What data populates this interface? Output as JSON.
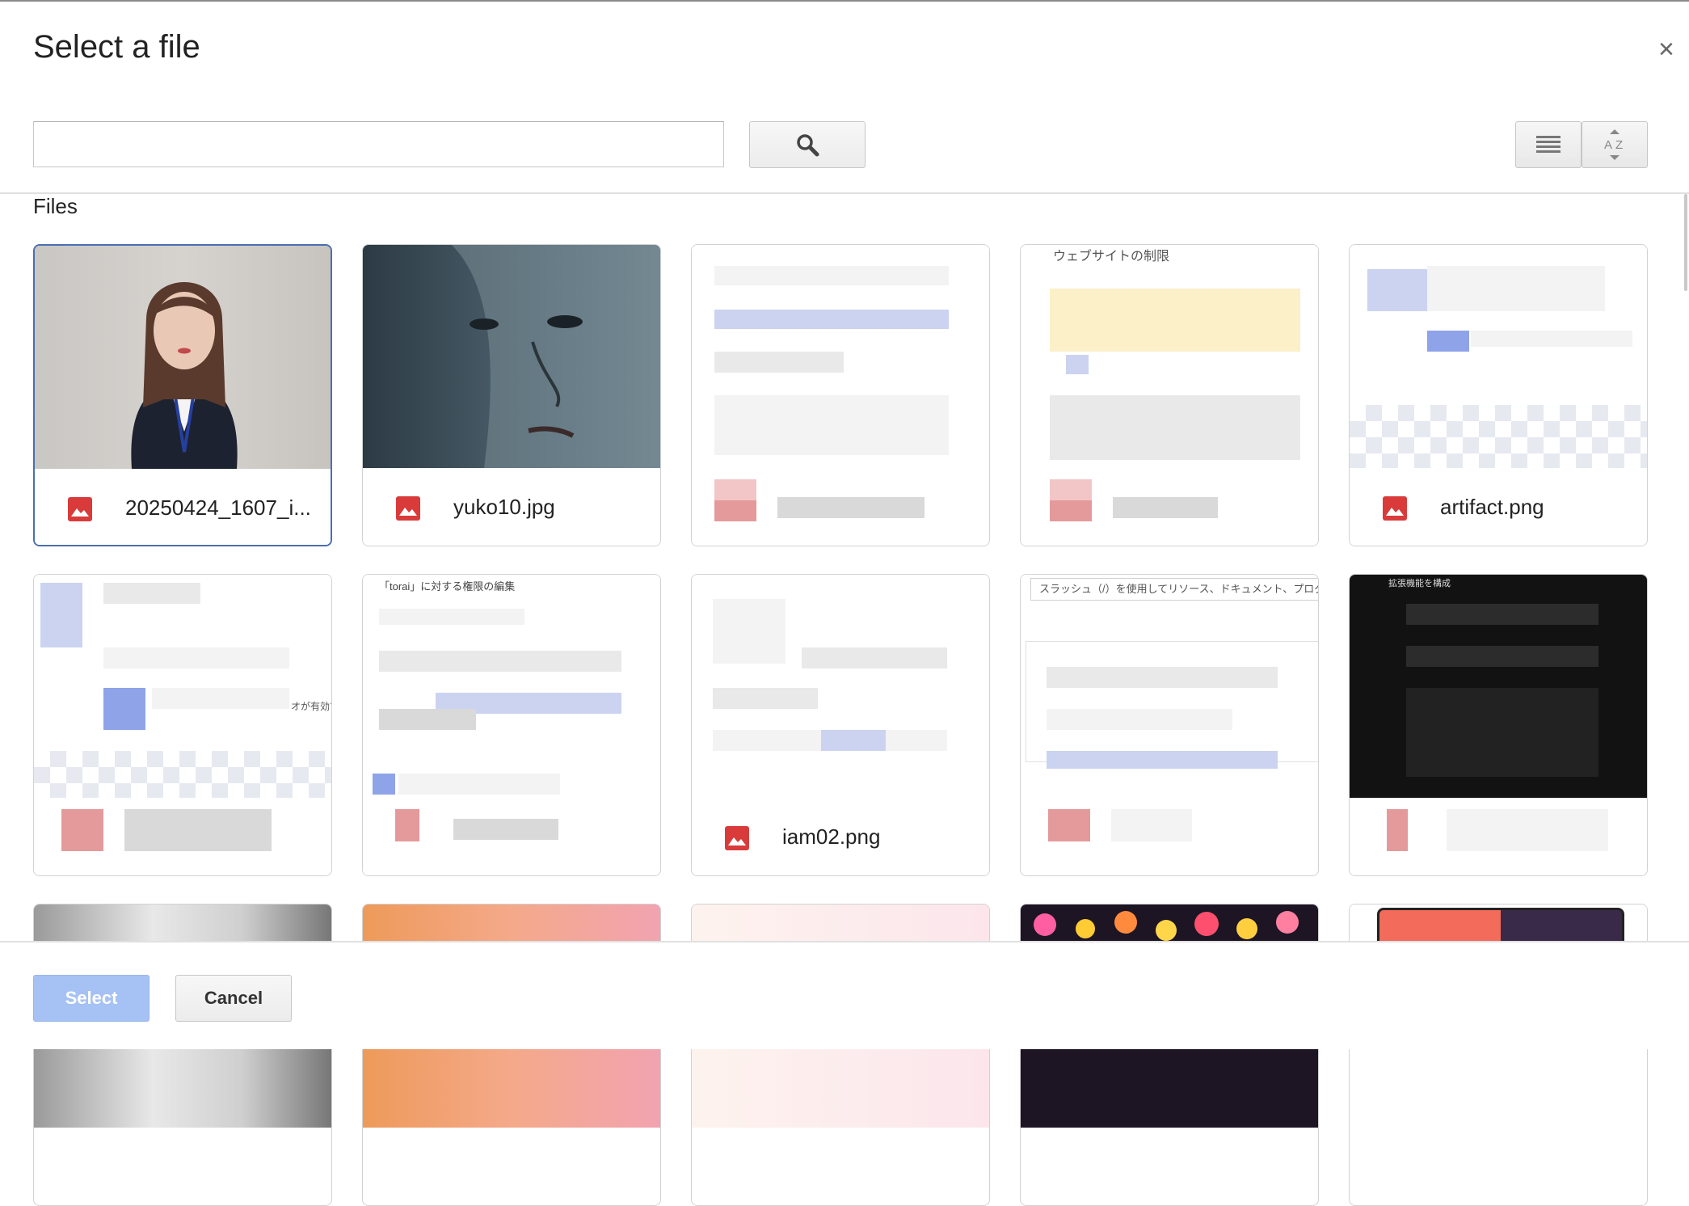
{
  "dialog": {
    "title": "Select a file",
    "close_label": "×",
    "section_label": "Files"
  },
  "search": {
    "value": "",
    "placeholder": "",
    "button_icon": "search-icon"
  },
  "view_controls": {
    "list_icon": "list-view-icon",
    "sort_icon": "sort-az-icon",
    "sort_label": "A↓Z"
  },
  "files": [
    {
      "name": "20250424_1607_i...",
      "icon": "image-file-icon",
      "selected": true
    },
    {
      "name": "yuko10.jpg",
      "icon": "image-file-icon",
      "selected": false
    },
    {
      "name": "",
      "icon": "image-file-icon",
      "selected": false
    },
    {
      "name": "",
      "icon": "image-file-icon",
      "selected": false,
      "thumb_text": "ウェブサイトの制限"
    },
    {
      "name": "artifact.png",
      "icon": "image-file-icon",
      "selected": false
    },
    {
      "name": "",
      "icon": "image-file-icon",
      "selected": false,
      "thumb_text": "オが有効て"
    },
    {
      "name": "",
      "icon": "image-file-icon",
      "selected": false,
      "thumb_text": "「torai」に対する権限の編集"
    },
    {
      "name": "iam02.png",
      "icon": "image-file-icon",
      "selected": false
    },
    {
      "name": "",
      "icon": "image-file-icon",
      "selected": false,
      "thumb_text": "スラッシュ（/）を使用してリソース、ドキュメント、プロダクト"
    },
    {
      "name": "",
      "icon": "image-file-icon",
      "selected": false,
      "thumb_text": "拡張機能を構成"
    }
  ],
  "footer": {
    "select_label": "Select",
    "cancel_label": "Cancel"
  },
  "colors": {
    "primary_disabled": "#a6c1f4",
    "selected_border": "#4a6fb0",
    "image_icon": "#d93b3b"
  }
}
